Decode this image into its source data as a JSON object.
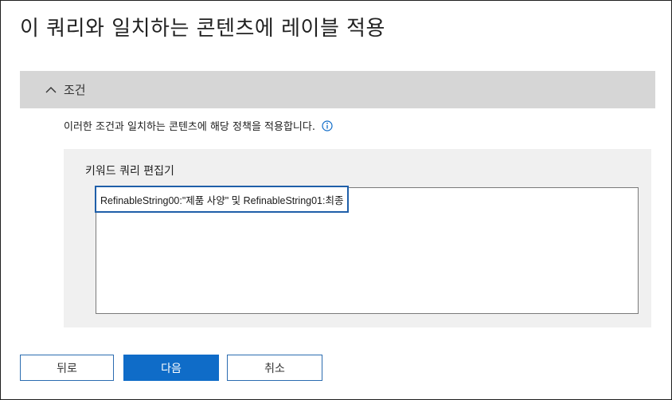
{
  "page": {
    "title": "이 쿼리와 일치하는 콘텐츠에 레이블 적용"
  },
  "conditions": {
    "header_label": "조건",
    "description": "이러한 조건과 일치하는 콘텐츠에 해당 정책을 적용합니다.",
    "icons": {
      "collapse": "chevron-up-icon",
      "info": "info-icon"
    }
  },
  "editor": {
    "label": "키워드 쿼리 편집기",
    "query_value": "RefinableString00:\"제품 사양\" 및 RefinableString01:최종"
  },
  "buttons": {
    "back_label": "뒤로",
    "next_label": "다음",
    "cancel_label": "취소"
  },
  "colors": {
    "primary": "#0f6cc8",
    "header_bg": "#d6d6d6",
    "panel_bg": "#f0f0f0",
    "highlight_border": "#1f5fa9"
  }
}
